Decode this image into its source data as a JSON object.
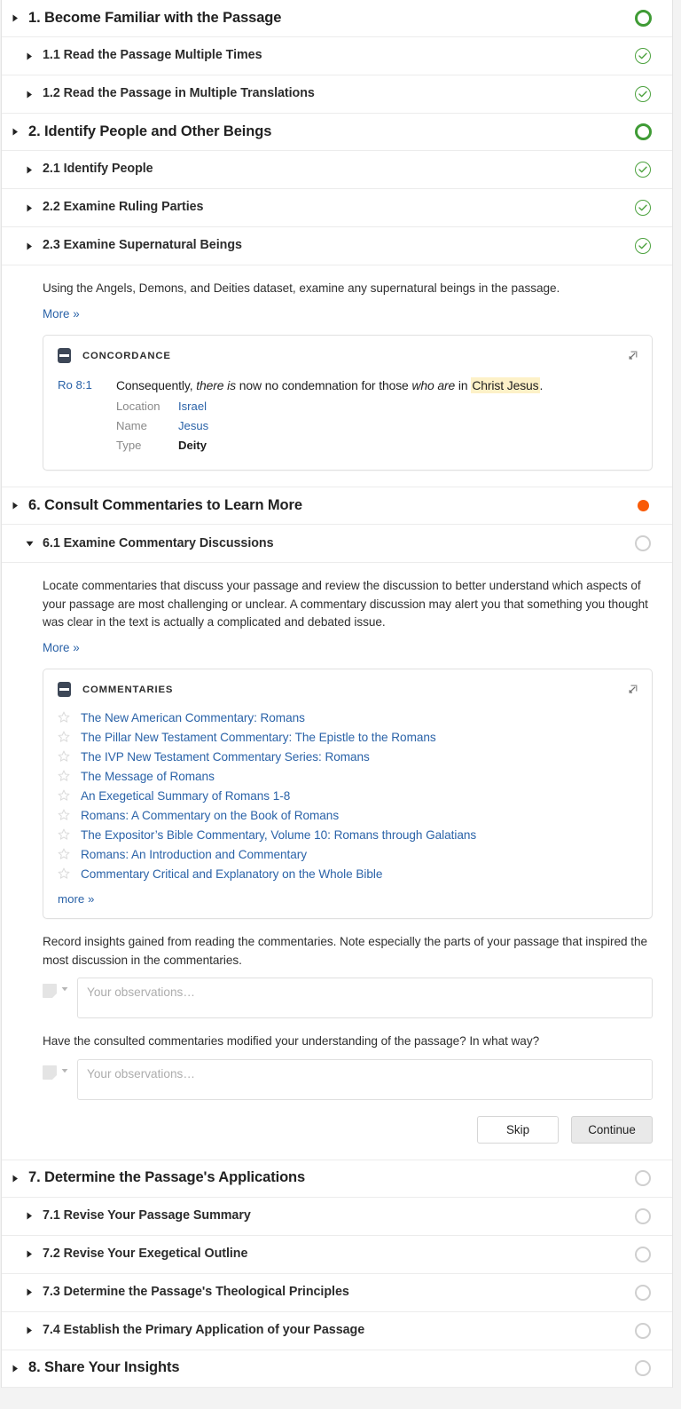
{
  "sections": [
    {
      "id": "s1",
      "level": 1,
      "label": "1. Become Familiar with the Passage",
      "arrow": "right",
      "status": "ring-green"
    },
    {
      "id": "s1-1",
      "level": 2,
      "label": "1.1 Read the Passage Multiple Times",
      "arrow": "right",
      "status": "check-green"
    },
    {
      "id": "s1-2",
      "level": 2,
      "label": "1.2 Read the Passage in Multiple Translations",
      "arrow": "right",
      "status": "check-green"
    },
    {
      "id": "s2",
      "level": 1,
      "label": "2. Identify People and Other Beings",
      "arrow": "right",
      "status": "ring-green"
    },
    {
      "id": "s2-1",
      "level": 2,
      "label": "2.1 Identify People",
      "arrow": "right",
      "status": "check-green"
    },
    {
      "id": "s2-2",
      "level": 2,
      "label": "2.2 Examine Ruling Parties",
      "arrow": "right",
      "status": "check-green"
    },
    {
      "id": "s2-3",
      "level": 2,
      "label": "2.3 Examine Supernatural Beings",
      "arrow": "right",
      "status": "check-green"
    }
  ],
  "supernatural_body": {
    "description": "Using the Angels, Demons, and Deities dataset, examine any supernatural beings in the passage.",
    "more_label": "More »",
    "widget": {
      "icon": "book-icon",
      "title": "CONCORDANCE",
      "expand_icon": "expand-icon",
      "entry": {
        "reference": "Ro 8:1",
        "verse_pre": "Consequently, ",
        "verse_ital1": "there is",
        "verse_mid": " now no condemnation for those ",
        "verse_ital2": "who are",
        "verse_post": " in ",
        "verse_highlight": "Christ Jesus",
        "verse_end": ".",
        "meta": [
          {
            "key": "Location",
            "value": "Israel",
            "style": "link"
          },
          {
            "key": "Name",
            "value": "Jesus",
            "style": "link"
          },
          {
            "key": "Type",
            "value": "Deity",
            "style": "strong"
          }
        ]
      }
    }
  },
  "section6": {
    "header": {
      "label": "6. Consult Commentaries to Learn More",
      "arrow": "right",
      "status": "dot-orange"
    },
    "sub": {
      "label": "6.1 Examine Commentary Discussions",
      "arrow": "down",
      "status": "ring-gray"
    },
    "description": "Locate commentaries that discuss your passage and review the discussion to better understand which aspects of your passage are most challenging or unclear. A commentary discussion may alert you that something you thought was clear in the text is actually a complicated and debated issue.",
    "more_label": "More »",
    "widget": {
      "icon": "book-icon",
      "title": "COMMENTARIES",
      "expand_icon": "expand-icon",
      "items": [
        "The New American Commentary: Romans",
        "The Pillar New Testament Commentary: The Epistle to the Romans",
        "The IVP New Testament Commentary Series: Romans",
        "The Message of Romans",
        "An Exegetical Summary of Romans 1-8",
        "Romans: A Commentary on the Book of Romans",
        "The Expositor’s Bible Commentary, Volume 10: Romans through Galatians",
        "Romans: An Introduction and Commentary",
        "Commentary Critical and Explanatory on the Whole Bible"
      ],
      "more_label": "more »"
    },
    "questions": [
      {
        "prompt": "Record insights gained from reading the commentaries. Note especially the parts of your passage that inspired the most discussion in the commentaries.",
        "placeholder": "Your observations…",
        "value": ""
      },
      {
        "prompt": "Have the consulted commentaries modified your understanding of the passage? In what way?",
        "placeholder": "Your observations…",
        "value": ""
      }
    ],
    "buttons": {
      "skip_label": "Skip",
      "continue_label": "Continue"
    }
  },
  "sections_tail": [
    {
      "id": "s7",
      "level": 1,
      "label": "7. Determine the Passage's Applications",
      "arrow": "right",
      "status": "ring-gray"
    },
    {
      "id": "s7-1",
      "level": 2,
      "label": "7.1 Revise Your Passage Summary",
      "arrow": "right",
      "status": "ring-gray"
    },
    {
      "id": "s7-2",
      "level": 2,
      "label": "7.2 Revise Your Exegetical Outline",
      "arrow": "right",
      "status": "ring-gray"
    },
    {
      "id": "s7-3",
      "level": 2,
      "label": "7.3 Determine the Passage's Theological Principles",
      "arrow": "right",
      "status": "ring-gray"
    },
    {
      "id": "s7-4",
      "level": 2,
      "label": "7.4 Establish the Primary Application of your Passage",
      "arrow": "right",
      "status": "ring-gray"
    },
    {
      "id": "s8",
      "level": 1,
      "label": "8. Share Your Insights",
      "arrow": "right",
      "status": "ring-gray"
    }
  ],
  "colors": {
    "green": "#3f9b35",
    "orange": "#f95b07",
    "link": "#2b63a8",
    "highlight": "#fdf1c8",
    "widget_icon": "#3d4757"
  }
}
